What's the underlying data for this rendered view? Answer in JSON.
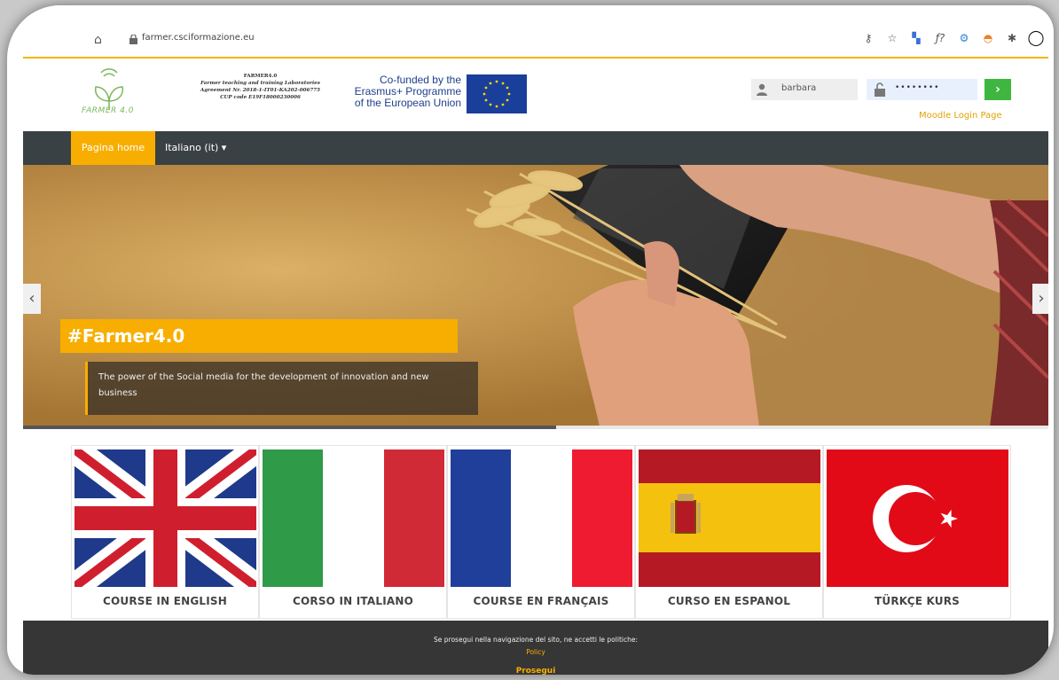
{
  "browser": {
    "url": "farmer.csciformazione.eu"
  },
  "header": {
    "logo_text": "FARMER 4.0",
    "project_title": "FARMER4.0",
    "project_line1": "Farmer teaching and training Laboratories",
    "project_line2": "Agreement Nr. 2018-1-IT01-KA202-006775",
    "project_line3": "CUP code E19F18000230006",
    "eu_line1": "Co-funded by the",
    "eu_line2": "Erasmus+ Programme",
    "eu_line3": "of the European Union",
    "username_value": "barbara",
    "password_value": "••••••••",
    "login_button": "›",
    "moodle_link": "Moodle Login Page"
  },
  "nav": {
    "home": "Pagina home",
    "language": "Italiano (it) ▾"
  },
  "hero": {
    "title": "#Farmer4.0",
    "caption": "The power of the Social media for the development of innovation and new business",
    "prev": "‹",
    "next": "›",
    "progress": 0.52
  },
  "courses": [
    {
      "label": "COURSE IN ENGLISH",
      "flag": "uk-flag"
    },
    {
      "label": "CORSO IN ITALIANO",
      "flag": "italy-flag"
    },
    {
      "label": "COURSE EN FRANÇAIS",
      "flag": "france-flag"
    },
    {
      "label": "CURSO EN ESPANOL",
      "flag": "spain-flag"
    },
    {
      "label": "TÜRKÇE KURS",
      "flag": "turkey-flag"
    }
  ],
  "cookie": {
    "text": "Se prosegui nella navigazione del sito, ne accetti le politiche:",
    "policy": "Policy",
    "button": "Prosegui"
  },
  "colors": {
    "accent": "#f8ae00",
    "navbar": "#3a4144",
    "go_button": "#3fb640",
    "footer": "#363636"
  }
}
